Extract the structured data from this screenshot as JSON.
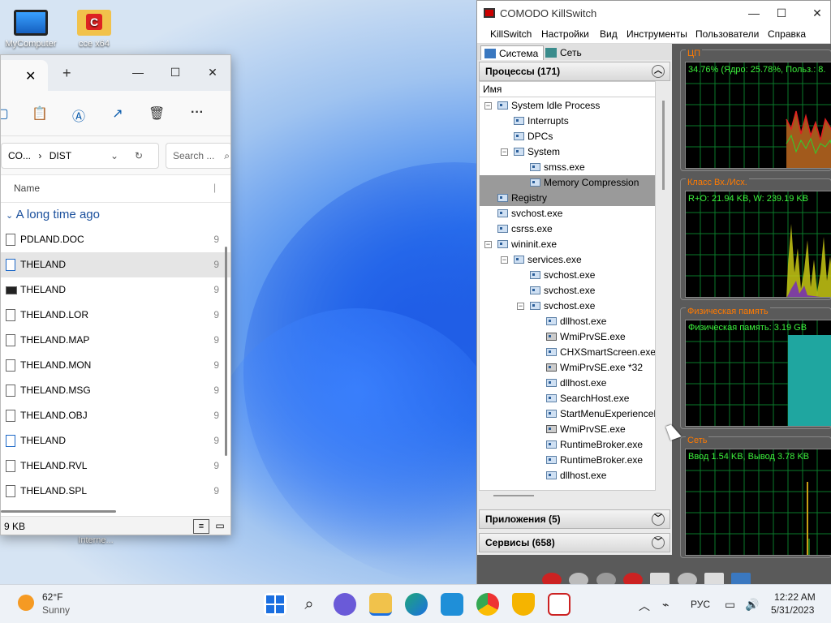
{
  "desktop": {
    "icons": [
      {
        "label": "MyComputer"
      },
      {
        "label": "cce x64"
      },
      {
        "label": "Interne..."
      }
    ]
  },
  "explorer": {
    "breadcrumb_part1": "CO...",
    "breadcrumb_sep": "›",
    "breadcrumb_part2": "DIST",
    "search_placeholder": "Search ...",
    "column_name": "Name",
    "group_label": "A long time ago",
    "files": [
      {
        "name": "PDLAND.DOC",
        "icon": "document-icon"
      },
      {
        "name": "THELAND",
        "icon": "exe-icon"
      },
      {
        "name": "THELAND",
        "icon": "console-icon"
      },
      {
        "name": "THELAND.LOR",
        "icon": "document-icon"
      },
      {
        "name": "THELAND.MAP",
        "icon": "text-document-icon"
      },
      {
        "name": "THELAND.MON",
        "icon": "document-icon"
      },
      {
        "name": "THELAND.MSG",
        "icon": "document-icon"
      },
      {
        "name": "THELAND.OBJ",
        "icon": "settings-file-icon"
      },
      {
        "name": "THELAND",
        "icon": "shortcut-icon"
      },
      {
        "name": "THELAND.RVL",
        "icon": "document-icon"
      },
      {
        "name": "THELAND.SPL",
        "icon": "document-icon"
      }
    ],
    "size_col_value": "9",
    "status_size": "9 KB"
  },
  "killswitch": {
    "title": "COMODO KillSwitch",
    "menu": [
      "KillSwitch",
      "Настройки",
      "Вид",
      "Инструменты",
      "Пользователи",
      "Справка"
    ],
    "tabs": [
      "Система",
      "Сеть"
    ],
    "processes_header": "Процессы (171)",
    "column_name": "Имя",
    "tree": [
      {
        "name": "System Idle Process",
        "level": 0,
        "exp": "−"
      },
      {
        "name": "Interrupts",
        "level": 1,
        "exp": ""
      },
      {
        "name": "DPCs",
        "level": 1,
        "exp": ""
      },
      {
        "name": "System",
        "level": 1,
        "exp": "−"
      },
      {
        "name": "smss.exe",
        "level": 2,
        "exp": ""
      },
      {
        "name": "Memory Compression",
        "level": 2,
        "exp": "",
        "hl": true
      },
      {
        "name": "Registry",
        "level": 0,
        "exp": "",
        "hl": true
      },
      {
        "name": "svchost.exe",
        "level": 0,
        "exp": ""
      },
      {
        "name": "csrss.exe",
        "level": 0,
        "exp": ""
      },
      {
        "name": "wininit.exe",
        "level": 0,
        "exp": "−"
      },
      {
        "name": "services.exe",
        "level": 1,
        "exp": "−"
      },
      {
        "name": "svchost.exe",
        "level": 2,
        "exp": ""
      },
      {
        "name": "svchost.exe",
        "level": 2,
        "exp": ""
      },
      {
        "name": "svchost.exe",
        "level": 2,
        "exp": "−"
      },
      {
        "name": "dllhost.exe",
        "level": 3,
        "exp": ""
      },
      {
        "name": "WmiPrvSE.exe",
        "level": 3,
        "exp": "",
        "gear": true
      },
      {
        "name": "CHXSmartScreen.exe",
        "level": 3,
        "exp": ""
      },
      {
        "name": "WmiPrvSE.exe *32",
        "level": 3,
        "exp": "",
        "gear": true
      },
      {
        "name": "dllhost.exe",
        "level": 3,
        "exp": ""
      },
      {
        "name": "SearchHost.exe",
        "level": 3,
        "exp": ""
      },
      {
        "name": "StartMenuExperienceH",
        "level": 3,
        "exp": ""
      },
      {
        "name": "WmiPrvSE.exe",
        "level": 3,
        "exp": "",
        "gear": true
      },
      {
        "name": "RuntimeBroker.exe",
        "level": 3,
        "exp": ""
      },
      {
        "name": "RuntimeBroker.exe",
        "level": 3,
        "exp": ""
      },
      {
        "name": "dllhost.exe",
        "level": 3,
        "exp": ""
      }
    ],
    "apps_header": "Приложения (5)",
    "services_header": "Сервисы (658)",
    "graphs": [
      {
        "title": "ЦП",
        "label": "34.76% (Ядро: 25.78%, Польз.: 8."
      },
      {
        "title": "Класс Вх./Исх.",
        "label": "R+O: 21.94 KB, W: 239.19 KB"
      },
      {
        "title": "Физическая память",
        "label": "Физическая память: 3.19 GB"
      },
      {
        "title": "Сеть",
        "label": "Ввод 1.54 KB, Вывод 3.78 KB"
      }
    ]
  },
  "taskbar": {
    "weather_temp": "62°F",
    "weather_desc": "Sunny",
    "lang": "РУС",
    "time": "12:22 AM",
    "date": "5/31/2023"
  }
}
